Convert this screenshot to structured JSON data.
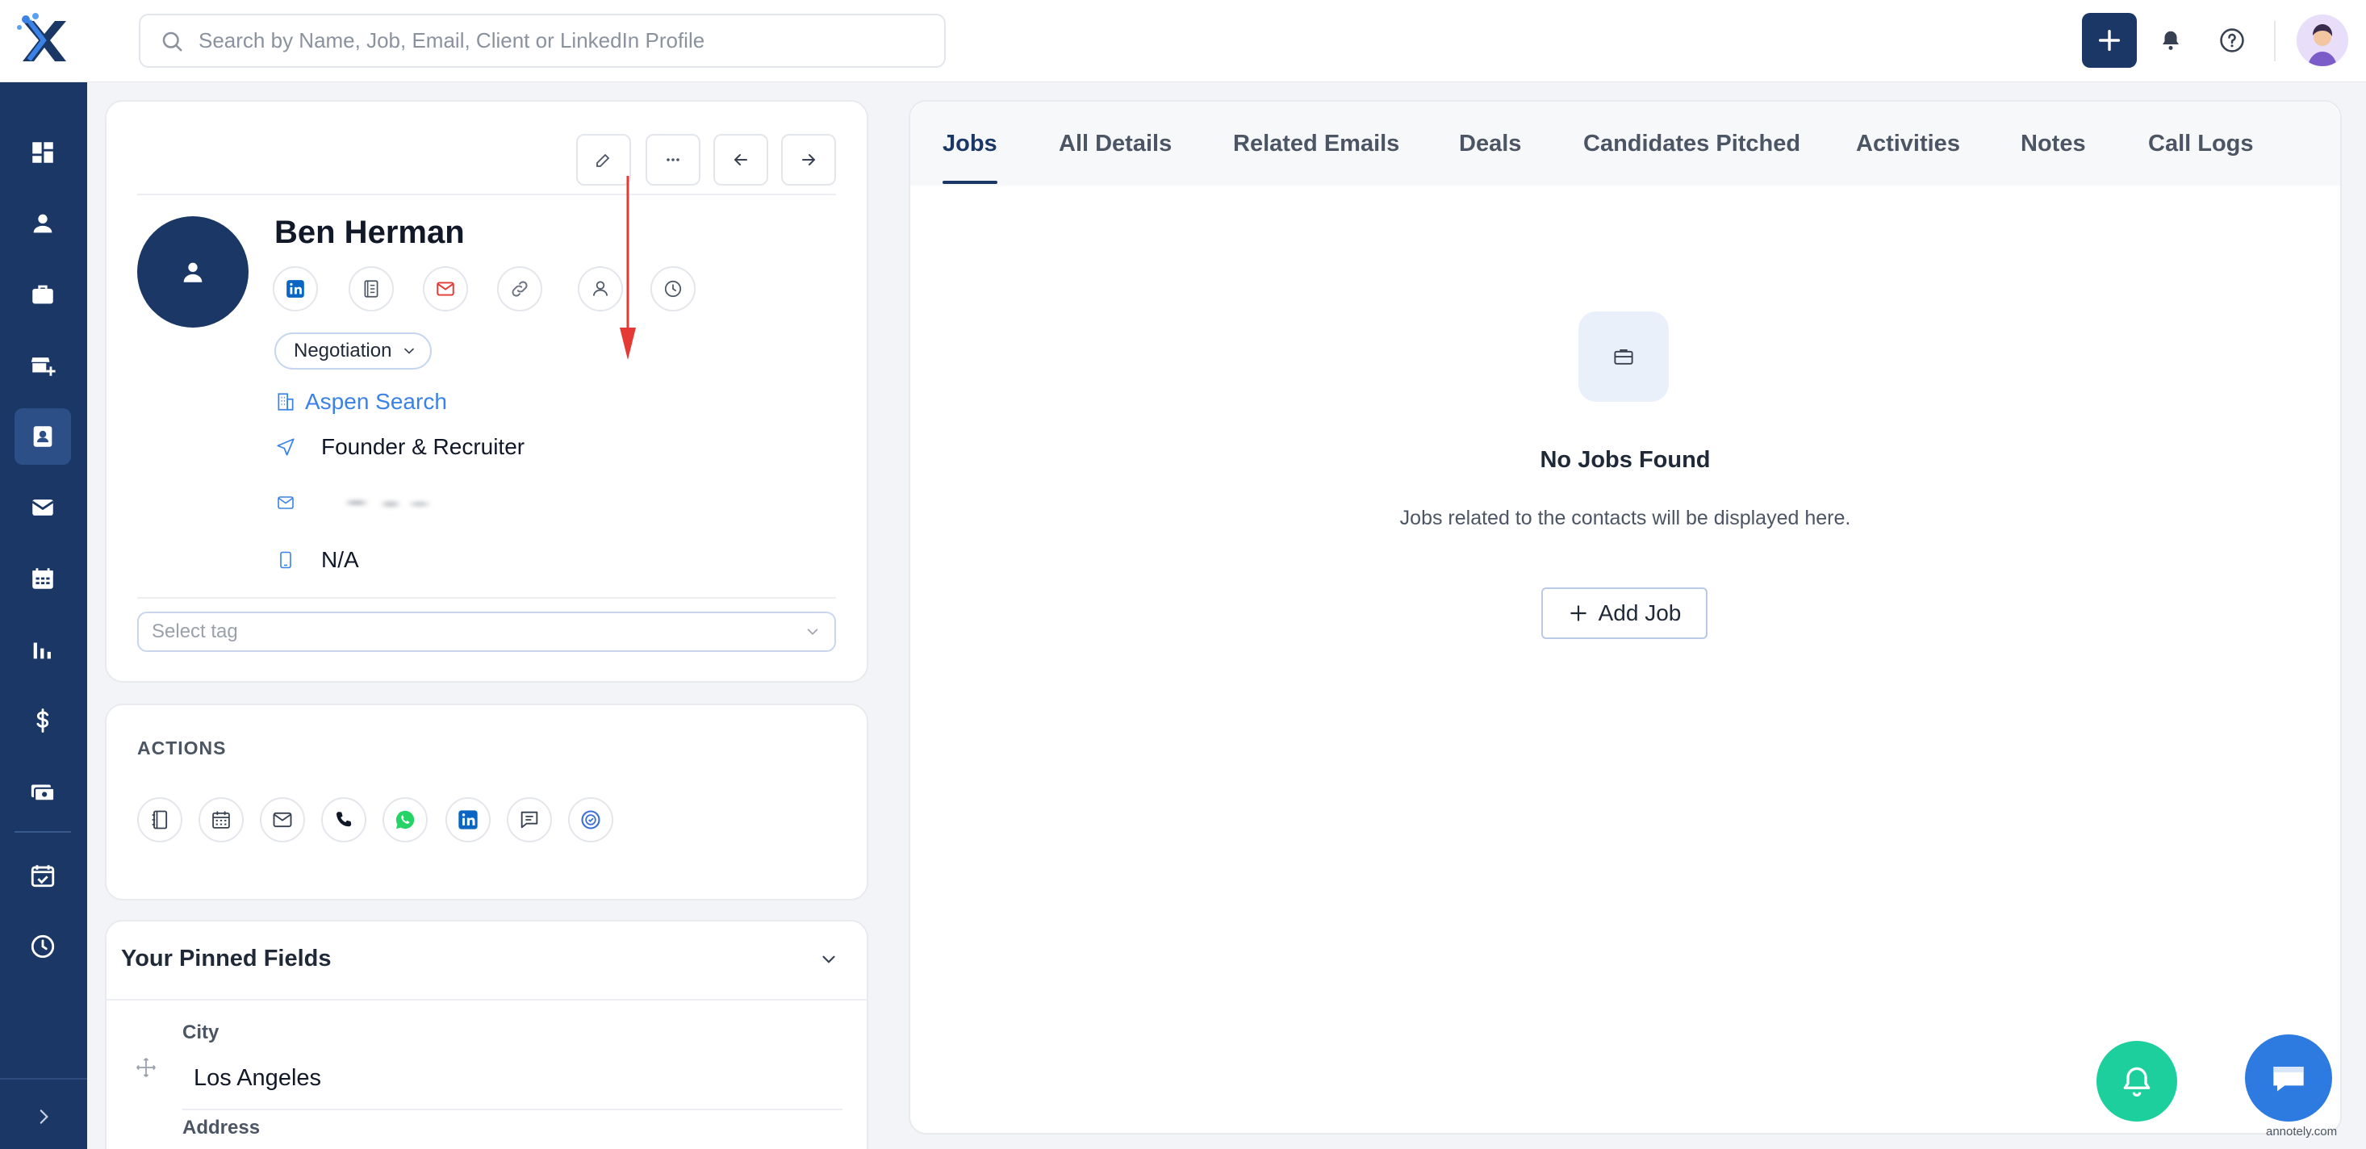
{
  "app": {
    "logo_icon": "x-logo-icon",
    "search_placeholder": "Search by Name, Job, Email, Client or LinkedIn Profile",
    "header_icons": [
      "add-icon",
      "bell-icon",
      "help-icon",
      "user-avatar"
    ],
    "brand_color": "#1a3765",
    "accent_color": "#3b82e6"
  },
  "sidebar": {
    "items": [
      {
        "icon": "dashboard-icon",
        "active": false
      },
      {
        "icon": "person-icon",
        "active": false
      },
      {
        "icon": "briefcase-icon",
        "active": false
      },
      {
        "icon": "store-add-icon",
        "active": false
      },
      {
        "icon": "contacts-icon",
        "active": true
      },
      {
        "icon": "mail-icon",
        "active": false
      },
      {
        "icon": "calendar-icon",
        "active": false
      },
      {
        "icon": "reports-icon",
        "active": false
      },
      {
        "icon": "dollar-icon",
        "active": false
      },
      {
        "icon": "payments-icon",
        "active": false
      },
      {
        "icon": "task-icon",
        "active": false
      },
      {
        "icon": "clock-icon",
        "active": false
      }
    ],
    "expand_icon": "chevron-right-icon"
  },
  "contact": {
    "name": "Ben Herman",
    "stage": "Negotiation",
    "company": "Aspen Search",
    "title": "Founder & Recruiter",
    "phone": "N/A",
    "tag_placeholder": "Select tag",
    "header_buttons": [
      "edit-icon",
      "more-icon",
      "arrow-left-icon",
      "arrow-right-icon"
    ],
    "quick_icons": [
      "linkedin-icon",
      "document-icon",
      "gmail-icon",
      "link-icon",
      "user-icon",
      "history-icon"
    ]
  },
  "actions": {
    "title": "ACTIONS",
    "icons": [
      "notebook-icon",
      "calendar-icon",
      "mail-icon",
      "phone-icon",
      "whatsapp-icon",
      "linkedin-icon",
      "chat-icon",
      "target-icon"
    ]
  },
  "pinned": {
    "title": "Your Pinned Fields",
    "fields": [
      {
        "label": "City",
        "value": "Los Angeles"
      },
      {
        "label": "Address",
        "value": ""
      }
    ]
  },
  "tabs": [
    {
      "label": "Jobs",
      "active": true
    },
    {
      "label": "All Details",
      "active": false
    },
    {
      "label": "Related Emails",
      "active": false
    },
    {
      "label": "Deals",
      "active": false
    },
    {
      "label": "Candidates Pitched",
      "active": false
    },
    {
      "label": "Activities",
      "active": false
    },
    {
      "label": "Notes",
      "active": false
    },
    {
      "label": "Call Logs",
      "active": false
    }
  ],
  "jobs_empty": {
    "title": "No Jobs Found",
    "subtitle": "Jobs related to the contacts will be displayed here.",
    "button": "Add Job"
  },
  "watermark": "annotely.com"
}
